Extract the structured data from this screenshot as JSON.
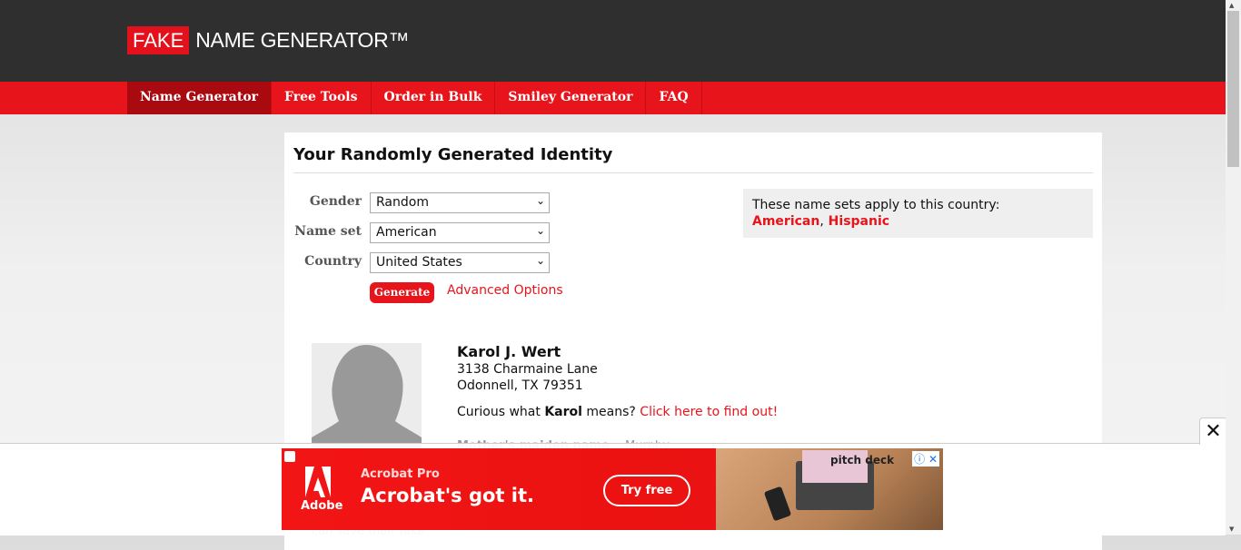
{
  "header": {
    "logo_fake": "FAKE",
    "logo_rest": "NAME GENERATOR™"
  },
  "nav": {
    "items": [
      {
        "label": "Name Generator",
        "active": true
      },
      {
        "label": "Free Tools"
      },
      {
        "label": "Order in Bulk"
      },
      {
        "label": "Smiley Generator"
      },
      {
        "label": "FAQ"
      }
    ]
  },
  "panel": {
    "title": "Your Randomly Generated Identity",
    "form": {
      "gender_label": "Gender",
      "gender_value": "Random",
      "nameset_label": "Name set",
      "nameset_value": "American",
      "country_label": "Country",
      "country_value": "United States",
      "generate_label": "Generate",
      "advanced_label": "Advanced Options"
    },
    "info": {
      "text": "These name sets apply to this country:",
      "link1": "American",
      "separator": ",",
      "link2": "Hispanic"
    },
    "identity": {
      "name": "Karol J. Wert",
      "address1": "3138 Charmaine Lane",
      "address2": "Odonnell, TX 79351",
      "curious_prefix": "Curious what",
      "curious_name": "Karol",
      "curious_suffix": "means?",
      "curious_link": "Click here to find out!",
      "maiden_label": "Mother's maiden name",
      "maiden_value": "Murphy",
      "faded_bottom": "can save their fake"
    }
  },
  "ad": {
    "brand": "Adobe",
    "product": "Acrobat Pro",
    "headline": "Acrobat's got it.",
    "cta": "Try free",
    "photo_text": "pitch deck",
    "close_glyph": "✕",
    "adchoices_glyph": "ⓘ ✕"
  },
  "colors": {
    "brand_red": "#e7141b",
    "dark_header": "#2f2f2f"
  }
}
